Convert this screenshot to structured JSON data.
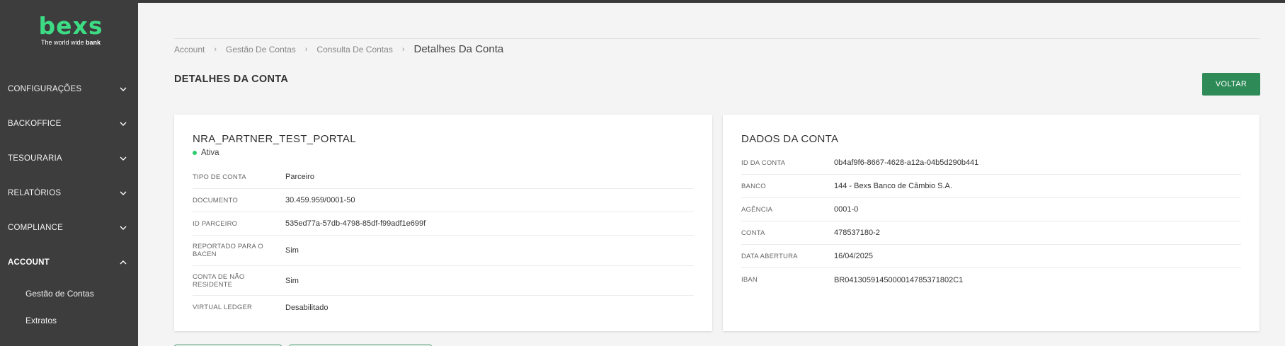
{
  "sidebar": {
    "logo_word": "bexs",
    "logo_tagline": "The world wide ",
    "logo_tagline_bold": "bank",
    "items": [
      {
        "label": "CONFIGURAÇÕES",
        "expanded": false
      },
      {
        "label": "BACKOFFICE",
        "expanded": false
      },
      {
        "label": "TESOURARIA",
        "expanded": false
      },
      {
        "label": "RELATÓRIOS",
        "expanded": false
      },
      {
        "label": "COMPLIANCE",
        "expanded": false
      },
      {
        "label": "ACCOUNT",
        "expanded": true
      }
    ],
    "sub_items": [
      {
        "label": "Gestão de Contas"
      },
      {
        "label": "Extratos"
      }
    ]
  },
  "breadcrumb": {
    "items": [
      "Account",
      "Gestão De Contas",
      "Consulta De Contas"
    ],
    "current": "Detalhes Da Conta"
  },
  "page": {
    "title": "DETALHES DA CONTA",
    "back_label": "VOLTAR"
  },
  "account_card": {
    "name": "NRA_PARTNER_TEST_PORTAL",
    "status": "Ativa",
    "rows": [
      {
        "label": "TIPO DE CONTA",
        "value": "Parceiro"
      },
      {
        "label": "DOCUMENTO",
        "value": "30.459.959/0001-50"
      },
      {
        "label": "ID PARCEIRO",
        "value": "535ed77a-57db-4798-85df-f99adf1e699f"
      },
      {
        "label": "REPORTADO PARA O BACEN",
        "value": "Sim"
      },
      {
        "label": "CONTA DE NÃO RESIDENTE",
        "value": "Sim"
      },
      {
        "label": "VIRTUAL LEDGER",
        "value": "Desabilitado"
      }
    ]
  },
  "data_card": {
    "title": "DADOS DA CONTA",
    "rows": [
      {
        "label": "ID DA CONTA",
        "value": "0b4af9f6-8667-4628-a12a-04b5d290b441"
      },
      {
        "label": "BANCO",
        "value": "144 - Bexs Banco de Câmbio S.A."
      },
      {
        "label": "AGÊNCIA",
        "value": "0001-0"
      },
      {
        "label": "CONTA",
        "value": "478537180-2"
      },
      {
        "label": "DATA ABERTURA",
        "value": "16/04/2025"
      },
      {
        "label": "IBAN",
        "value": "BR0413059145000014785371802C1"
      }
    ]
  },
  "colors": {
    "sidebar_bg": "#3d3d3d",
    "brand_green": "#3ddc84",
    "button_green": "#2e8b57",
    "status_active": "#2ecc71",
    "page_bg": "#f4f4f4"
  }
}
